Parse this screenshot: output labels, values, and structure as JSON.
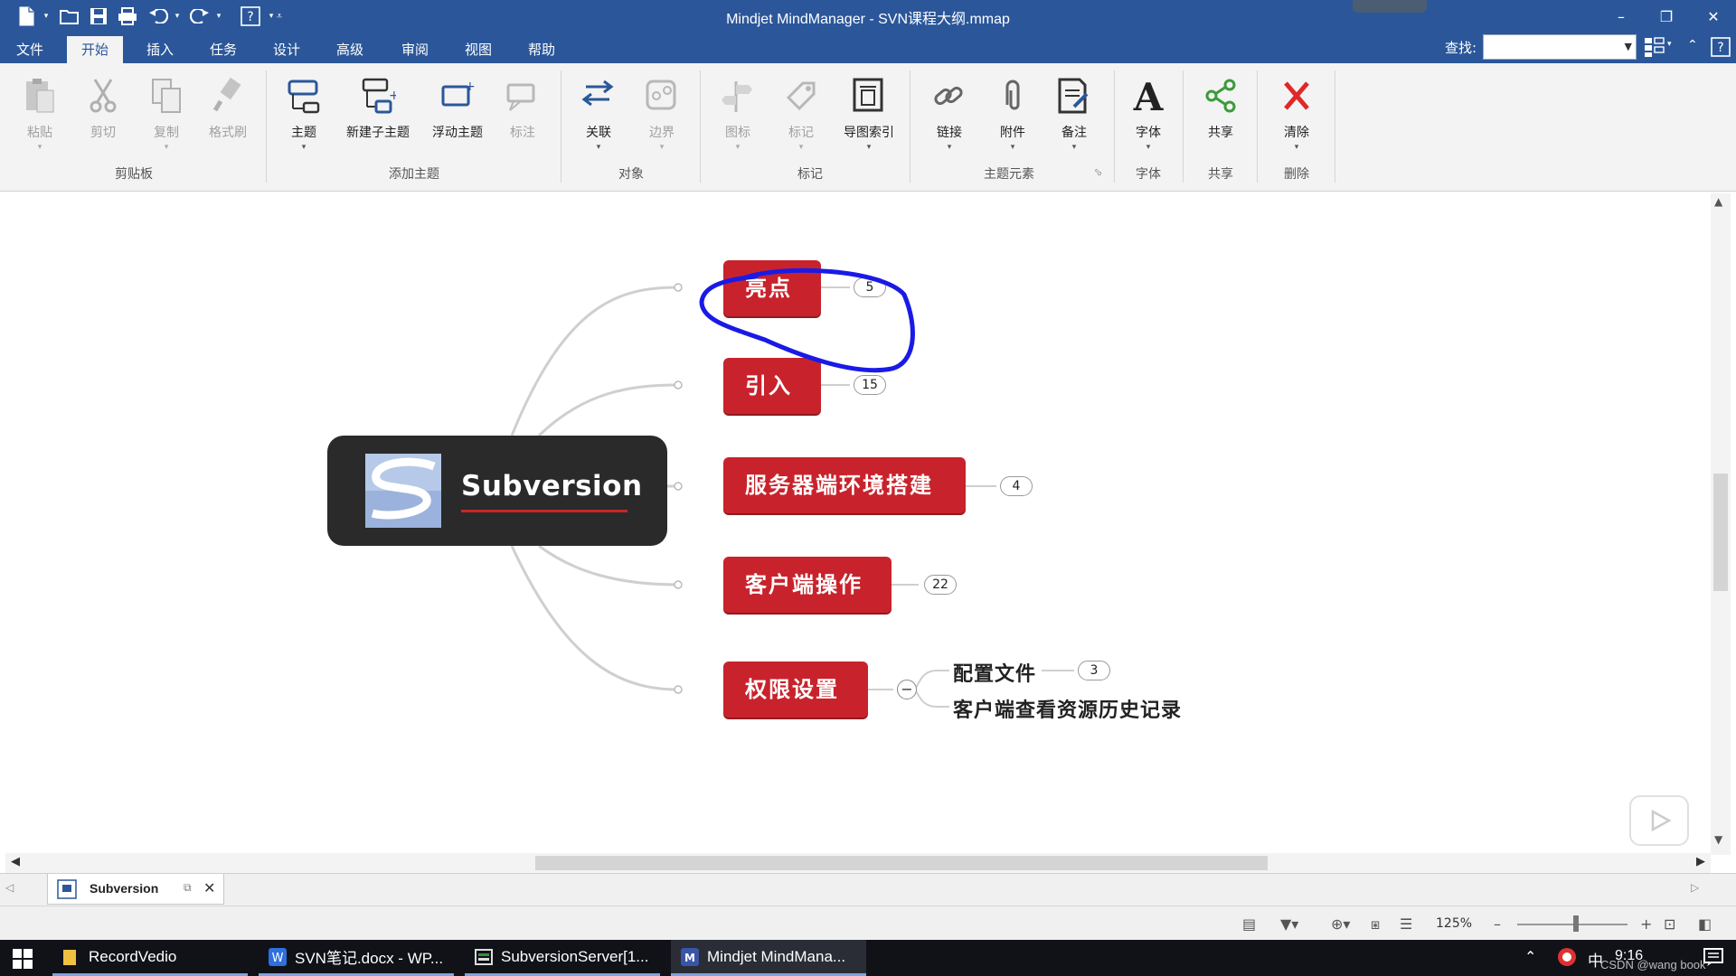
{
  "window": {
    "title": "Mindjet MindManager - SVN课程大纲.mmap",
    "min": "–",
    "restore": "❐",
    "close": "✕"
  },
  "menu": {
    "tabs": [
      "文件",
      "开始",
      "插入",
      "任务",
      "设计",
      "高级",
      "审阅",
      "视图",
      "帮助"
    ],
    "active": "开始",
    "find_label": "查找:",
    "find_value": ""
  },
  "ribbon": {
    "clipboard": {
      "group": "剪贴板",
      "paste": "粘贴",
      "cut": "剪切",
      "copy": "复制",
      "format_painter": "格式刷"
    },
    "add_topic": {
      "group": "添加主题",
      "topic": "主题",
      "subtopic": "新建子主题",
      "floating": "浮动主题",
      "callout": "标注"
    },
    "objects": {
      "group": "对象",
      "relationship": "关联",
      "boundary": "边界"
    },
    "markers": {
      "group": "标记",
      "icons": "图标",
      "tags": "标记",
      "index": "导图索引"
    },
    "topic_elements": {
      "group": "主题元素",
      "link": "链接",
      "attachment": "附件",
      "notes": "备注"
    },
    "font": {
      "group": "字体",
      "font": "字体"
    },
    "share": {
      "group": "共享",
      "share": "共享"
    },
    "delete": {
      "group": "删除",
      "clear": "清除"
    }
  },
  "map": {
    "central": "Subversion",
    "topics": [
      {
        "label": "亮点",
        "count": "5"
      },
      {
        "label": "引入",
        "count": "15"
      },
      {
        "label": "服务器端环境搭建",
        "count": "4"
      },
      {
        "label": "客户端操作",
        "count": "22"
      },
      {
        "label": "权限设置",
        "collapse": "−"
      }
    ],
    "subtopics": [
      {
        "label": "配置文件",
        "count": "3"
      },
      {
        "label": "客户端查看资源历史记录"
      }
    ],
    "annotation_color": "#1a1ae6"
  },
  "doc_tab": {
    "name": "Subversion"
  },
  "status": {
    "zoom": "125%"
  },
  "taskbar": {
    "items": [
      "RecordVedio",
      "SVN笔记.docx - WP...",
      "SubversionServer[1...",
      "Mindjet MindMana..."
    ],
    "ime": "中",
    "time": "9:16",
    "watermark": "CSDN @wang book"
  },
  "colors": {
    "titlebar": "#2b579a",
    "topic": "#c8232c",
    "central": "#2a2a2a"
  }
}
